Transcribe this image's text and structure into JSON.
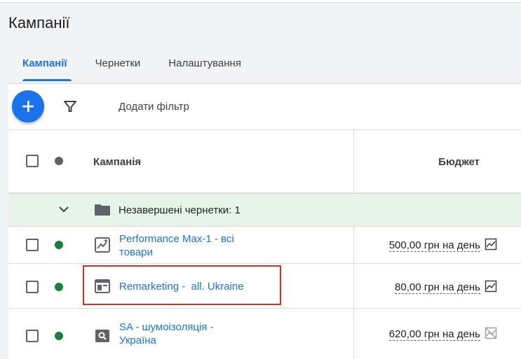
{
  "page": {
    "title": "Кампанії"
  },
  "tabs": [
    {
      "label": "Кампанії",
      "active": true
    },
    {
      "label": "Чернетки",
      "active": false
    },
    {
      "label": "Налаштування",
      "active": false
    }
  ],
  "toolbar": {
    "add_filter_label": "Додати фільтр",
    "fab_icon": "plus-icon",
    "filter_icon": "filter-icon"
  },
  "table": {
    "headers": {
      "campaign": "Кампанія",
      "budget": "Бюджет"
    },
    "group": {
      "label": "Незавершені чернетки: 1"
    },
    "rows": [
      {
        "name_line1": "Performance Max-1 - всі",
        "name_line2": "товари",
        "budget": "500,00 грн на день",
        "status_color": "#188038",
        "type_icon": "performance-max-icon",
        "highlighted": false
      },
      {
        "name_line1": "Remarketing -  all. Ukraine",
        "name_line2": "",
        "budget": "80,00 грн на день",
        "status_color": "#188038",
        "type_icon": "display-campaign-icon",
        "highlighted": true
      },
      {
        "name_line1": "SA - шумоізоляція -",
        "name_line2": "Україна",
        "budget": "620,00 грн на день",
        "status_color": "#188038",
        "type_icon": "search-campaign-icon",
        "highlighted": false
      }
    ]
  },
  "colors": {
    "accent": "#1a73e8",
    "group_bg": "#e6f4ea",
    "highlight": "#d93025",
    "status_enabled": "#188038",
    "header_dot": "#5f6368"
  }
}
